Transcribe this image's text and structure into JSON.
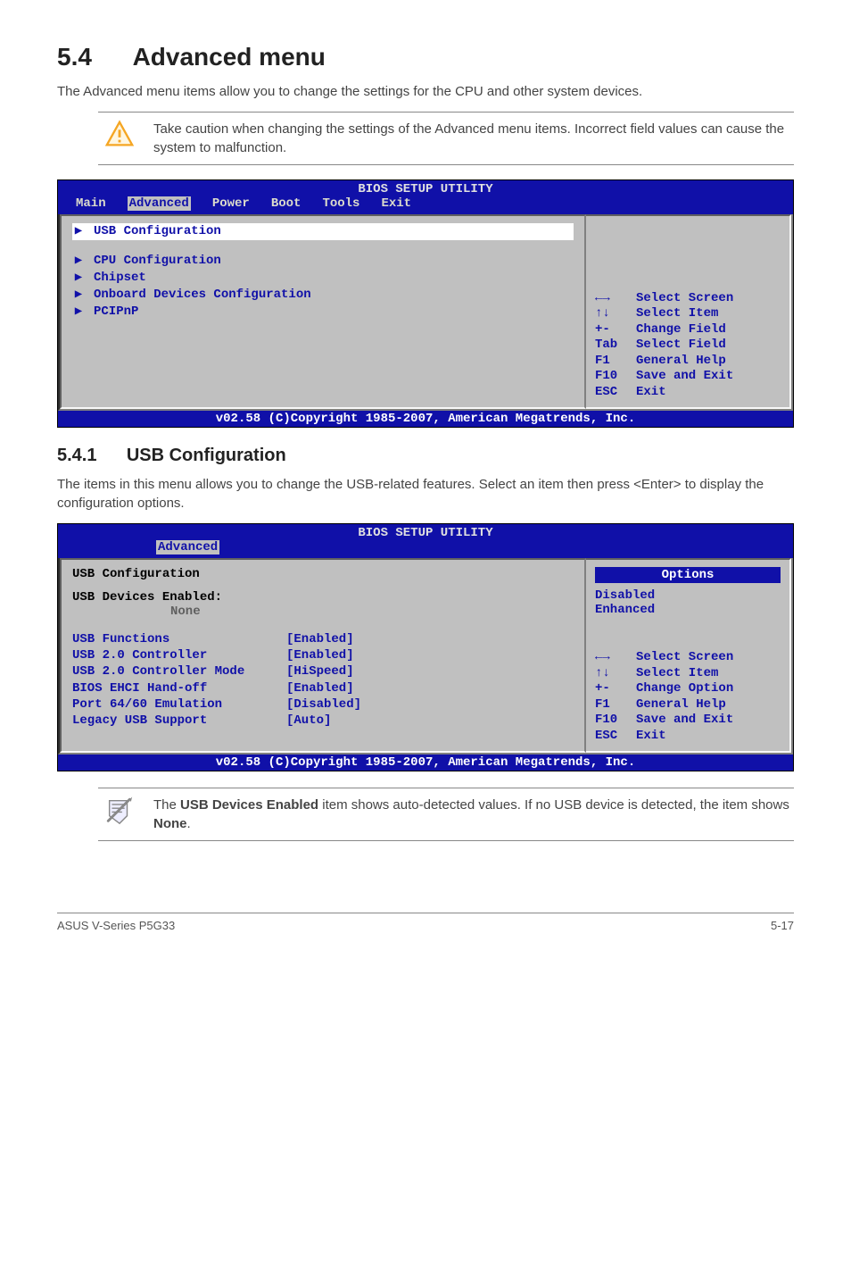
{
  "section": {
    "number": "5.4",
    "title": "Advanced menu",
    "intro": "The Advanced menu items allow you to change the settings for the CPU and other system devices.",
    "caution": "Take caution when changing the settings of the Advanced menu items. Incorrect field values can cause the system to malfunction."
  },
  "bios1": {
    "title": "BIOS SETUP UTILITY",
    "tabs": [
      "Main",
      "Advanced",
      "Power",
      "Boot",
      "Tools",
      "Exit"
    ],
    "active_tab": "Advanced",
    "selected": "USB Configuration",
    "items": [
      "CPU Configuration",
      "Chipset",
      "Onboard Devices Configuration",
      "PCIPnP"
    ],
    "help": [
      {
        "k": "←→",
        "v": "Select Screen"
      },
      {
        "k": "↑↓",
        "v": "Select Item"
      },
      {
        "k": "+-",
        "v": "Change Field"
      },
      {
        "k": "Tab",
        "v": "Select Field"
      },
      {
        "k": "F1",
        "v": "General Help"
      },
      {
        "k": "F10",
        "v": "Save and Exit"
      },
      {
        "k": "ESC",
        "v": "Exit"
      }
    ],
    "copyright": "v02.58 (C)Copyright 1985-2007, American Megatrends, Inc."
  },
  "subsection": {
    "number": "5.4.1",
    "title": "USB Configuration",
    "intro": "The items in this menu allows you to change the USB-related features. Select an item then press <Enter> to display the configuration options."
  },
  "bios2": {
    "title": "BIOS SETUP UTILITY",
    "active_tab": "Advanced",
    "group_title": "USB Configuration",
    "devices_label": "USB Devices Enabled:",
    "devices_value": "None",
    "settings": [
      {
        "label": "USB Functions",
        "value": "[Enabled]"
      },
      {
        "label": "USB 2.0 Controller",
        "value": "[Enabled]"
      },
      {
        "label": "USB 2.0 Controller Mode",
        "value": "[HiSpeed]"
      },
      {
        "label": "BIOS EHCI Hand-off",
        "value": "[Enabled]"
      },
      {
        "label": "Port 64/60 Emulation",
        "value": "[Disabled]"
      },
      {
        "label": "Legacy USB Support",
        "value": "[Auto]"
      }
    ],
    "options_title": "Options",
    "options": [
      "Disabled",
      "Enhanced"
    ],
    "help": [
      {
        "k": "←→",
        "v": "Select Screen"
      },
      {
        "k": "↑↓",
        "v": "Select Item"
      },
      {
        "k": "+-",
        "v": "Change Option"
      },
      {
        "k": "F1",
        "v": "General Help"
      },
      {
        "k": "F10",
        "v": "Save and Exit"
      },
      {
        "k": "ESC",
        "v": "Exit"
      }
    ],
    "copyright": "v02.58 (C)Copyright 1985-2007, American Megatrends, Inc."
  },
  "note": {
    "text_prefix": "The ",
    "bold1": "USB Devices Enabled",
    "text_mid": " item shows auto-detected values. If no USB device is detected, the item shows ",
    "bold2": "None",
    "text_suffix": "."
  },
  "footer": {
    "left": "ASUS V-Series P5G33",
    "right": "5-17"
  }
}
